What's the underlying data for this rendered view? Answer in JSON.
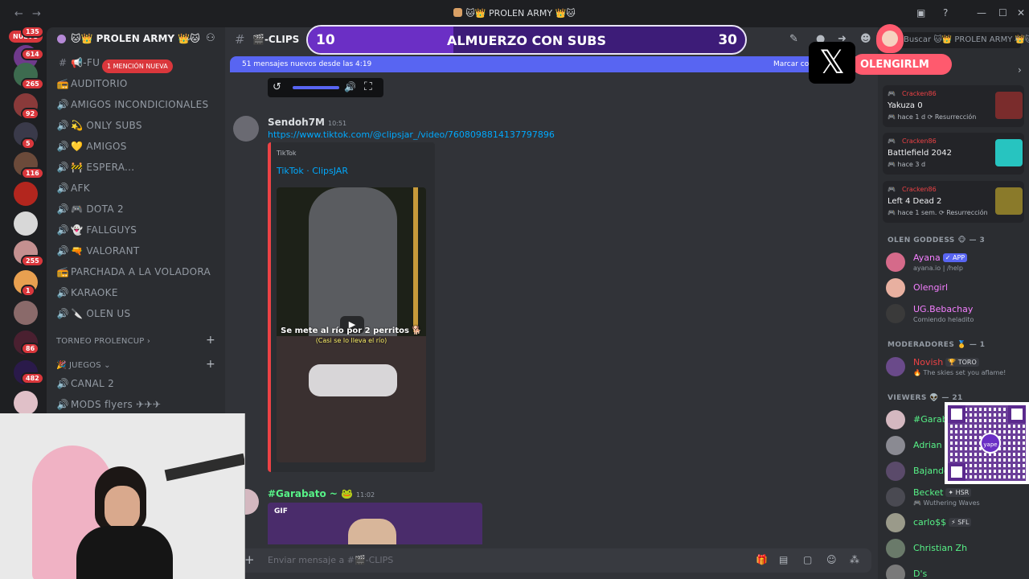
{
  "window": {
    "title": "🐱👑 PROLEN ARMY 👑🐱"
  },
  "servers": {
    "new_label": "NUEVO",
    "badges": [
      "135",
      "614",
      "265",
      "92",
      "5",
      "116",
      "255",
      "1",
      "86",
      "482"
    ]
  },
  "server_header": {
    "name": "🐱👑 PROLEN ARMY 👑🐱"
  },
  "channels": {
    "mention_pill": "1 MENCIÓN NUEVA",
    "items": [
      {
        "icon": "#",
        "label": "📢-FU"
      },
      {
        "icon": "📻",
        "label": "AUDITORIO"
      },
      {
        "icon": "🔊",
        "label": "AMIGOS INCONDICIONALES"
      },
      {
        "icon": "🔊",
        "label": "💫 ONLY SUBS"
      },
      {
        "icon": "🔊",
        "label": "💛 AMIGOS"
      },
      {
        "icon": "🔊",
        "label": "🚧 ESPERA..."
      },
      {
        "icon": "🔊",
        "label": "AFK"
      },
      {
        "icon": "🔊",
        "label": "🎮 DOTA 2"
      },
      {
        "icon": "🔊",
        "label": "👻 FALLGUYS"
      },
      {
        "icon": "🔊",
        "label": "🔫 VALORANT"
      },
      {
        "icon": "📻",
        "label": "PARCHADA A LA VOLADORA"
      },
      {
        "icon": "🔊",
        "label": "KARAOKE"
      },
      {
        "icon": "🔊",
        "label": "🔪 OLEN US"
      }
    ],
    "category_torneo": "TORNEO PROLENCUP ›",
    "category_juegos": "🎉 JUEGOS ⌄",
    "juegos_items": [
      {
        "icon": "🔊",
        "label": "CANAL 2"
      },
      {
        "icon": "🔊",
        "label": "MODS flyers ✈✈✈"
      }
    ]
  },
  "chat": {
    "channel_name": "🎬-CLIPS",
    "new_messages_text": "51 mensajes nuevos desde las 4:19",
    "mark_read": "Marcar co",
    "messages": [
      {
        "author": "Sendoh7M",
        "time": "10:51",
        "author_color": "#f2f3f5",
        "link": "https://www.tiktok.com/@clipsjar_/video/7608098814137797896",
        "embed": {
          "provider": "TikTok",
          "title": "TikTok · ClipsJAR",
          "caption": "Se mete al río por 2 perritos 🐕",
          "subcaption": "(Casi se lo lleva el río)"
        }
      },
      {
        "author": "#Garabato ~ 🐸",
        "time": "11:02",
        "author_color": "#57f287",
        "gif_label": "GIF"
      }
    ],
    "input_placeholder": "Enviar mensaje a #🎬-CLIPS"
  },
  "members": {
    "search_placeholder": "Buscar 🐱👑 PROLEN ARMY 👑🐱",
    "activities": [
      {
        "user": "Cracken86",
        "game": "Yakuza 0",
        "meta": "🎮 hace 1 d   ⟳ Resurrección",
        "thumb_color": "#7a2c2c"
      },
      {
        "user": "Cracken86",
        "game": "Battlefield 2042",
        "meta": "🎮 hace 3 d",
        "thumb_color": "#27c4c0"
      },
      {
        "user": "Cracken86",
        "game": "Left 4 Dead 2",
        "meta": "🎮 hace 1 sem.  ⟳ Resurrección",
        "thumb_color": "#8a7a2a"
      }
    ],
    "groups": [
      {
        "title": "OLEN GODDESS 🐵 — 3"
      },
      {
        "title": "MODERADORES 🥇 — 1"
      },
      {
        "title": "VIEWERS 👽 — 21"
      }
    ],
    "goddess": [
      {
        "name": "Ayana",
        "tag": "✓ APP",
        "status": "ayana.io | /help",
        "color": "#f47fff"
      },
      {
        "name": "Olengirl",
        "tag": "",
        "status": "",
        "color": "#f47fff"
      },
      {
        "name": "UG.Bebachay",
        "tag": "",
        "status": "Comiendo heladito",
        "color": "#f47fff"
      }
    ],
    "mods": [
      {
        "name": "Novish",
        "tag": "🏆 TORO",
        "status": "🔥 The skies set you aflame!",
        "color": "#ed4245"
      }
    ],
    "viewers": [
      {
        "name": "#Garabato",
        "tag": "",
        "status": "",
        "color": "#57f287"
      },
      {
        "name": "Adrian",
        "tag": "",
        "status": "",
        "color": "#57f287"
      },
      {
        "name": "Bajando",
        "tag": "",
        "status": "",
        "color": "#57f287"
      },
      {
        "name": "Becket",
        "tag": "✦ HSR",
        "status": "🎮 Wuthering Waves",
        "color": "#57f287"
      },
      {
        "name": "carlo$$",
        "tag": "⚡ SFL",
        "status": "",
        "color": "#57f287"
      },
      {
        "name": "Christian Zh",
        "tag": "",
        "status": "",
        "color": "#57f287"
      },
      {
        "name": "D's",
        "tag": "",
        "status": "",
        "color": "#57f287"
      }
    ]
  },
  "overlay": {
    "goal_current": "10",
    "goal_title": "ALMUERZO CON SUBS",
    "goal_max": "30",
    "goal_progress": 0.333,
    "handle": "OLENGIRLM",
    "x_icon": "𝕏",
    "qr_brand": "yape"
  },
  "colors": {
    "accent": "#5865f2",
    "danger": "#da373c",
    "link": "#00a8fc"
  }
}
